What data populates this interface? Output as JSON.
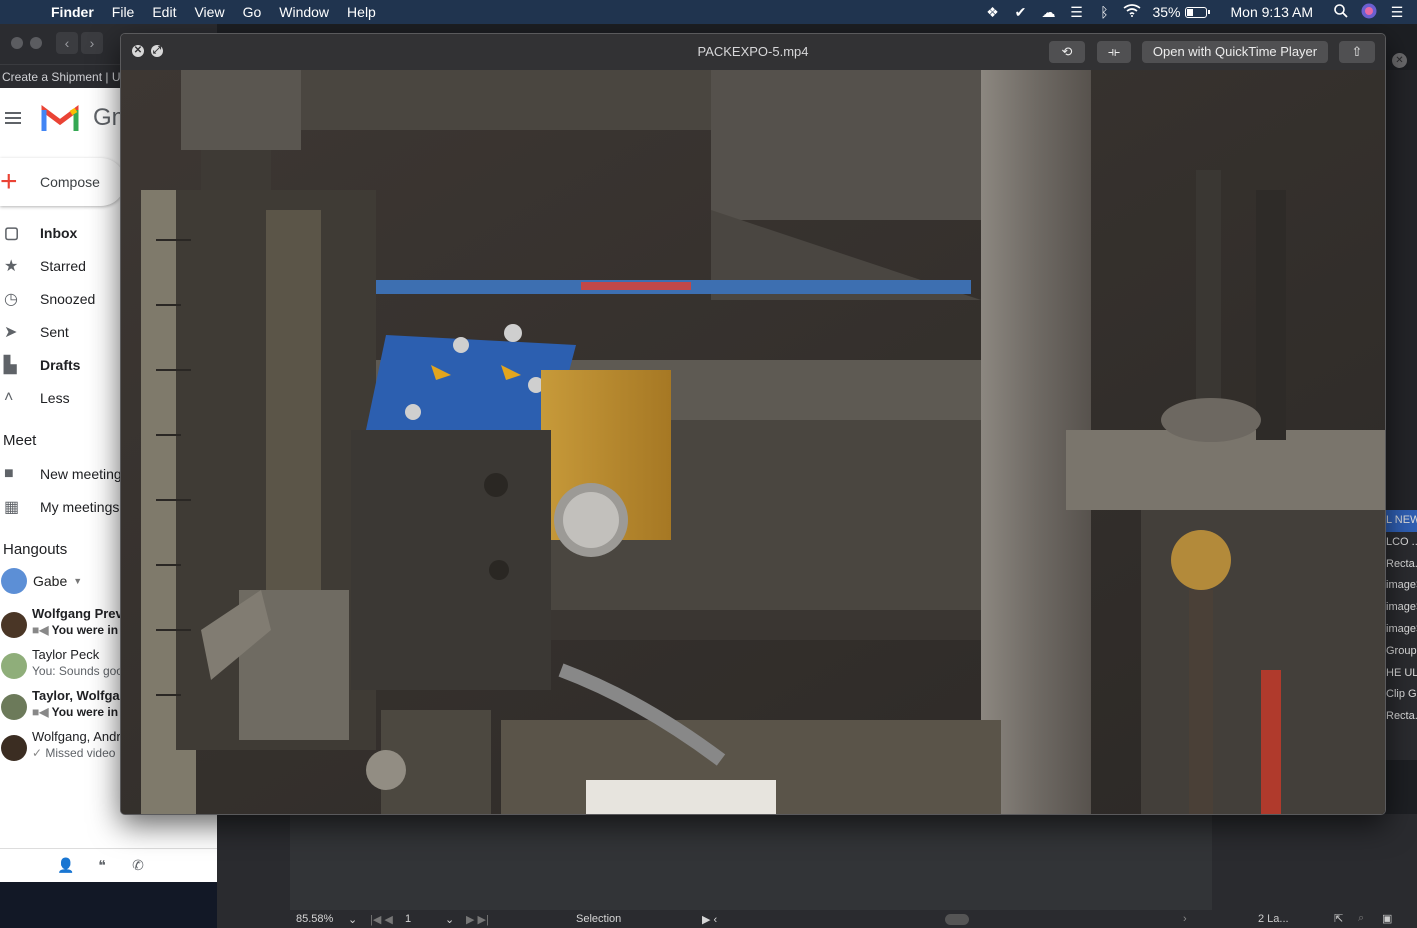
{
  "menubar": {
    "app_name": "Finder",
    "menus": [
      "File",
      "Edit",
      "View",
      "Go",
      "Window",
      "Help"
    ],
    "battery_percent": "35%",
    "battery_level": 0.35,
    "clock": "Mon 9:13 AM"
  },
  "browser": {
    "url_text": "Create a Shipment | UPS"
  },
  "gmail": {
    "wordmark": "Gmail",
    "compose_label": "Compose",
    "nav": [
      {
        "label": "Inbox",
        "icon": "inbox-icon",
        "bold": true
      },
      {
        "label": "Starred",
        "icon": "star-icon",
        "bold": false
      },
      {
        "label": "Snoozed",
        "icon": "clock-icon",
        "bold": false
      },
      {
        "label": "Sent",
        "icon": "send-icon",
        "bold": false
      },
      {
        "label": "Drafts",
        "icon": "draft-icon",
        "bold": true
      },
      {
        "label": "Less",
        "icon": "chevron-up-icon",
        "bold": false
      }
    ],
    "meet_title": "Meet",
    "meet_items": [
      {
        "label": "New meeting",
        "icon": "video-icon"
      },
      {
        "label": "My meetings",
        "icon": "calendar-icon"
      }
    ],
    "hangouts_title": "Hangouts",
    "hangouts_user": "Gabe",
    "chats": [
      {
        "name": "Wolfgang Prev",
        "sub": "You were in a",
        "bold": true,
        "color": "#4a3626"
      },
      {
        "name": "Taylor Peck",
        "sub": "You: Sounds good",
        "bold": false,
        "color": "#8fae7a"
      },
      {
        "name": "Taylor, Wolfga",
        "sub": "You were in a",
        "bold": true,
        "color": "#6c7a5a"
      },
      {
        "name": "Wolfgang, Andr",
        "sub": "Missed video",
        "bold": false,
        "color": "#3b2d22"
      }
    ]
  },
  "quicklook": {
    "title": "PACKEXPO-5.mp4",
    "open_with_label": "Open with QuickTime Player"
  },
  "background_app": {
    "zoom": "85.58%",
    "page": "1",
    "tool": "Selection",
    "layers": "2 La...",
    "panel_items": [
      "L NEW",
      "LCO ..",
      "Recta..",
      "image>",
      "image>",
      "image>",
      "Group>",
      "HE ULT",
      "Clip G.",
      "Recta.."
    ]
  },
  "colors": {
    "menubar": "#20344f",
    "gmail_red": "#ea4335",
    "selection_blue": "#2f5fb3"
  }
}
